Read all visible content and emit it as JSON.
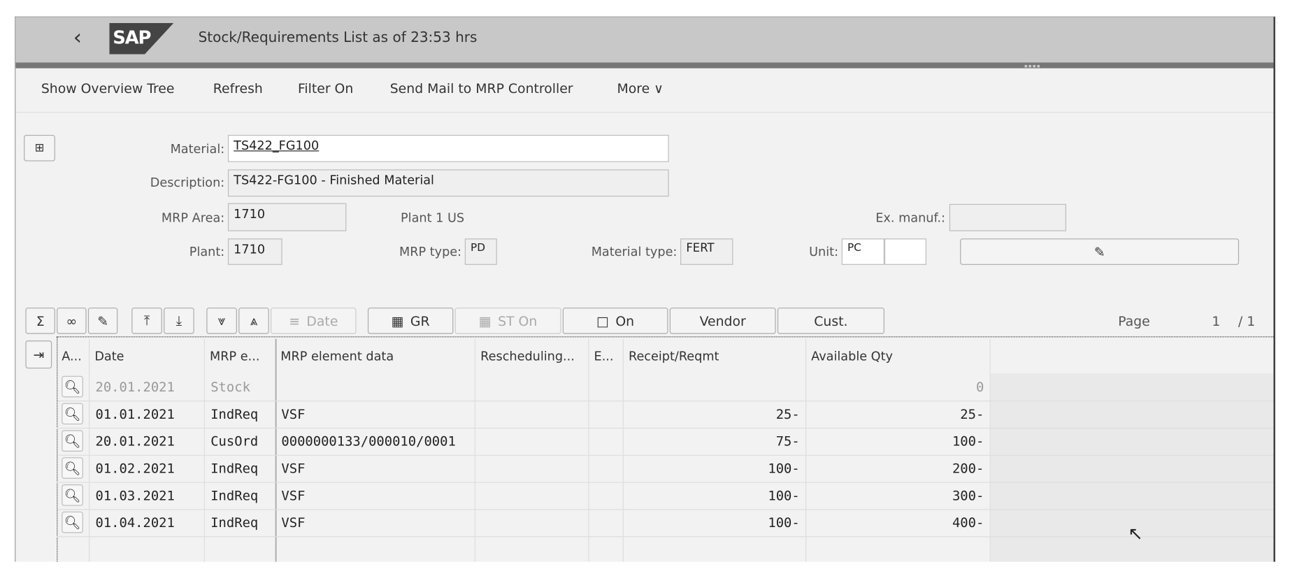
{
  "header": {
    "title": "Stock/Requirements List as of 23:53 hrs",
    "logo": "SAP"
  },
  "toolbar": {
    "items": [
      "Show Overview Tree",
      "Refresh",
      "Filter On",
      "Send Mail to MRP Controller",
      "More"
    ]
  },
  "form": {
    "material_label": "Material:",
    "material": "TS422_FG100",
    "description_label": "Description:",
    "description": "TS422-FG100 - Finished Material",
    "mrp_area_label": "MRP Area:",
    "mrp_area": "1710",
    "plant_text": "Plant 1 US",
    "ex_manuf_label": "Ex. manuf.:",
    "ex_manuf": "",
    "plant_label": "Plant:",
    "plant": "1710",
    "mrp_type_label": "MRP type:",
    "mrp_type": "PD",
    "material_type_label": "Material type:",
    "material_type": "FERT",
    "unit_label": "Unit:",
    "unit": "PC",
    "unit2": ""
  },
  "grid_toolbar": {
    "date": "Date",
    "gr": "GR",
    "st_on": "ST On",
    "on": "On",
    "vendor": "Vendor",
    "cust": "Cust.",
    "page_label": "Page",
    "page": "1",
    "page_total": "/ 1"
  },
  "table": {
    "columns": [
      "A...",
      "Date",
      "MRP e...",
      "MRP element data",
      "Rescheduling...",
      "E...",
      "Receipt/Reqmt",
      "Available Qty"
    ],
    "rows": [
      {
        "date": "20.01.2021",
        "element": "Stock",
        "data": "",
        "resched": "",
        "e": "",
        "receipt": "",
        "available": "0"
      },
      {
        "date": "01.01.2021",
        "element": "IndReq",
        "data": "VSF",
        "resched": "",
        "e": "",
        "receipt": "25-",
        "available": "25-"
      },
      {
        "date": "20.01.2021",
        "element": "CusOrd",
        "data": "0000000133/000010/0001",
        "resched": "",
        "e": "",
        "receipt": "75-",
        "available": "100-"
      },
      {
        "date": "01.02.2021",
        "element": "IndReq",
        "data": "VSF",
        "resched": "",
        "e": "",
        "receipt": "100-",
        "available": "200-"
      },
      {
        "date": "01.03.2021",
        "element": "IndReq",
        "data": "VSF",
        "resched": "",
        "e": "",
        "receipt": "100-",
        "available": "300-"
      },
      {
        "date": "01.04.2021",
        "element": "IndReq",
        "data": "VSF",
        "resched": "",
        "e": "",
        "receipt": "100-",
        "available": "400-"
      }
    ]
  }
}
